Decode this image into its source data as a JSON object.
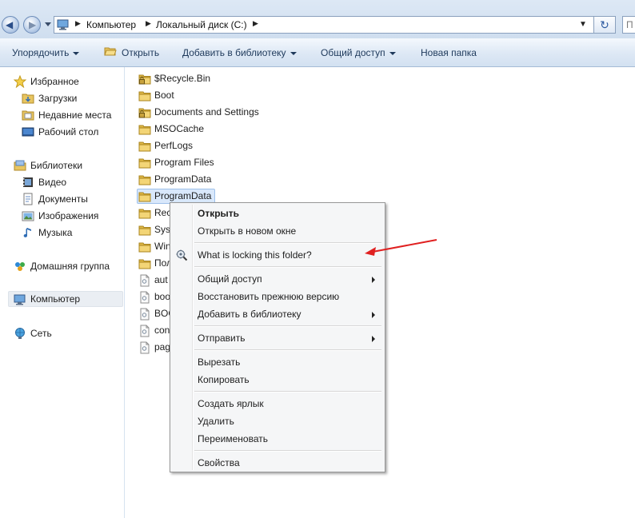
{
  "breadcrumb": {
    "items": [
      "Компьютер",
      "Локальный диск (C:)"
    ],
    "search_placeholder": "П"
  },
  "toolbar": {
    "organize": "Упорядочить",
    "open": "Открыть",
    "add_to_library": "Добавить в библиотеку",
    "share": "Общий доступ",
    "new_folder": "Новая папка"
  },
  "nav": {
    "favorites": "Избранное",
    "downloads": "Загрузки",
    "recent": "Недавние места",
    "desktop": "Рабочий стол",
    "libraries": "Библиотеки",
    "video": "Видео",
    "documents": "Документы",
    "images": "Изображения",
    "music": "Музыка",
    "homegroup": "Домашняя группа",
    "computer": "Компьютер",
    "network": "Сеть"
  },
  "files": [
    {
      "name": "$Recycle.Bin",
      "icon": "locked-folder-icon"
    },
    {
      "name": "Boot",
      "icon": "folder-icon"
    },
    {
      "name": "Documents and Settings",
      "icon": "locked-folder-icon"
    },
    {
      "name": "MSOCache",
      "icon": "folder-icon"
    },
    {
      "name": "PerfLogs",
      "icon": "folder-icon"
    },
    {
      "name": "Program Files",
      "icon": "folder-icon"
    },
    {
      "name": "ProgramData",
      "icon": "folder-icon"
    },
    {
      "name": "ProgramData",
      "icon": "folder-icon",
      "selected": true
    },
    {
      "name": "Rec",
      "icon": "folder-icon"
    },
    {
      "name": "Syst",
      "icon": "folder-icon"
    },
    {
      "name": "Win",
      "icon": "folder-icon"
    },
    {
      "name": "Пол",
      "icon": "folder-icon"
    },
    {
      "name": "aut",
      "icon": "file-icon"
    },
    {
      "name": "boo",
      "icon": "file-icon"
    },
    {
      "name": "BOO",
      "icon": "file-icon"
    },
    {
      "name": "con",
      "icon": "file-icon"
    },
    {
      "name": "pag",
      "icon": "file-icon"
    }
  ],
  "context_menu": {
    "open": "Открыть",
    "open_new_window": "Открыть в новом окне",
    "what_is_locking": "What is locking this folder?",
    "share": "Общий доступ",
    "restore_previous": "Восстановить прежнюю версию",
    "add_to_library": "Добавить в библиотеку",
    "send_to": "Отправить",
    "cut": "Вырезать",
    "copy": "Копировать",
    "create_shortcut": "Создать ярлык",
    "delete": "Удалить",
    "rename": "Переименовать",
    "properties": "Свойства"
  },
  "colors": {
    "accent_arrow": "#e02020",
    "selection": "#d9e8fb",
    "toolbar_text": "#1e395b"
  }
}
